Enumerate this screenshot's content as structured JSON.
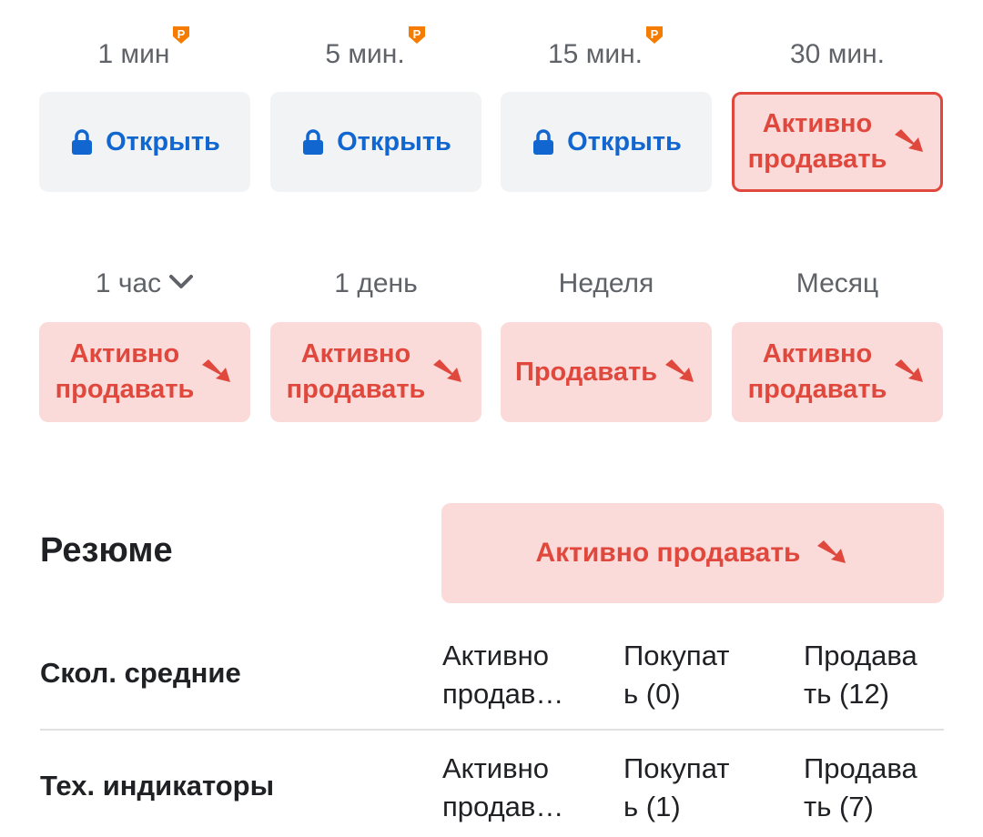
{
  "timeframes_row1": [
    {
      "label": "1 мин",
      "pro": true,
      "button": "Открыть",
      "locked": true
    },
    {
      "label": "5 мин.",
      "pro": true,
      "button": "Открыть",
      "locked": true
    },
    {
      "label": "15 мин.",
      "pro": true,
      "button": "Открыть",
      "locked": true
    },
    {
      "label": "30 мин.",
      "pro": false,
      "signal_line1": "Активно",
      "signal_line2": "продавать",
      "selected": true
    }
  ],
  "timeframes_row2": [
    {
      "label": "1 час",
      "dropdown": true,
      "signal_line1": "Активно",
      "signal_line2": "продавать"
    },
    {
      "label": "1 день",
      "signal_line1": "Активно",
      "signal_line2": "продавать"
    },
    {
      "label": "Неделя",
      "signal": "Продавать"
    },
    {
      "label": "Месяц",
      "signal_line1": "Активно",
      "signal_line2": "продавать"
    }
  ],
  "summary": {
    "title": "Резюме",
    "signal": "Активно продавать"
  },
  "rows": [
    {
      "label": "Скол. средние",
      "c1_l1": "Активно",
      "c1_l2": "продав…",
      "c2_l1": "Покупат",
      "c2_l2": "ь (0)",
      "c3_l1": "Продава",
      "c3_l2": "ть (12)"
    },
    {
      "label": "Тех. индикаторы",
      "c1_l1": "Активно",
      "c1_l2": "продав…",
      "c2_l1": "Покупат",
      "c2_l2": "ь (1)",
      "c3_l1": "Продава",
      "c3_l2": "ть (7)"
    }
  ],
  "colors": {
    "sell": "#e0483d",
    "sell_bg": "#fadbd9",
    "locked_text": "#1266cf",
    "locked_bg": "#f1f3f4",
    "pro_badge": "#f57c00"
  },
  "icons": {
    "pro": "pro-badge-icon",
    "lock": "lock-icon",
    "sell_arrow": "down-right-arrow-icon",
    "dropdown": "chevron-down-icon"
  }
}
